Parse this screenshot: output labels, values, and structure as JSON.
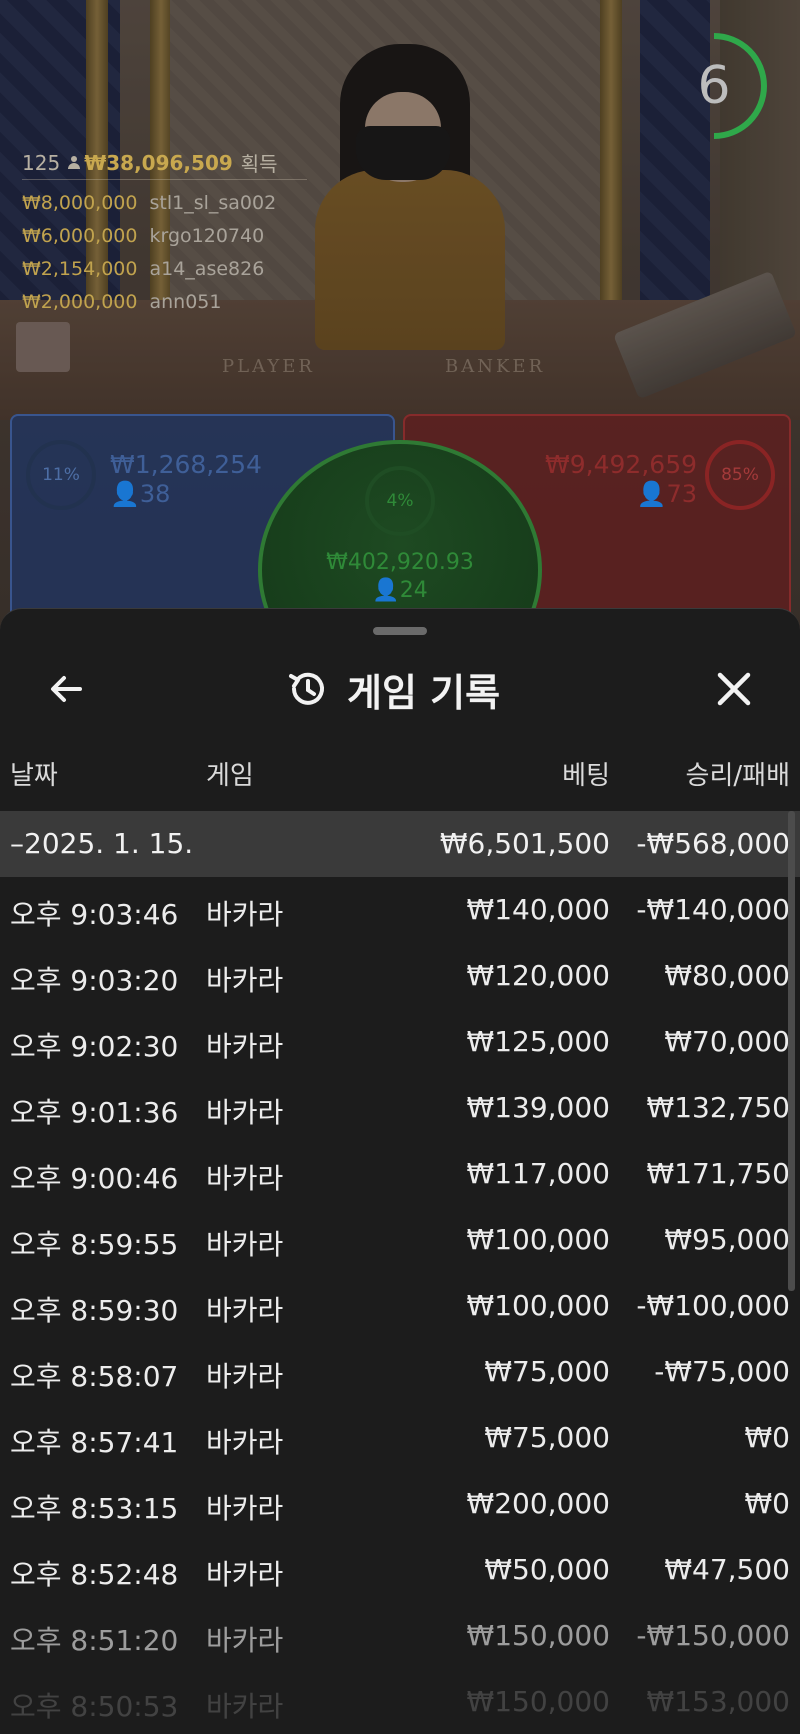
{
  "live": {
    "timer": "6",
    "winners_count": "125",
    "winners_total": "₩38,096,509",
    "winners_suffix": "획득",
    "winners": [
      {
        "amount": "₩8,000,000",
        "name": "stl1_sl_sa002"
      },
      {
        "amount": "₩6,000,000",
        "name": "krgo120740"
      },
      {
        "amount": "₩2,154,000",
        "name": "a14_ase826"
      },
      {
        "amount": "₩2,000,000",
        "name": "ann051"
      }
    ],
    "table_labels": {
      "player": "PLAYER",
      "banker": "BANKER"
    },
    "player": {
      "pct": "11%",
      "amount": "₩1,268,254",
      "count": "38"
    },
    "banker": {
      "pct": "85%",
      "amount": "₩9,492,659",
      "count": "73"
    },
    "tie": {
      "pct": "4%",
      "amount": "₩402,920.93",
      "count": "24"
    }
  },
  "history": {
    "title": "게임 기록",
    "columns": {
      "date": "날짜",
      "game": "게임",
      "bet": "베팅",
      "result": "승리/패배"
    },
    "day": {
      "date": "–2025. 1. 15.",
      "bet": "₩6,501,500",
      "result": "-₩568,000"
    },
    "rows": [
      {
        "time": "오후 9:03:46",
        "game": "바카라",
        "bet": "₩140,000",
        "result": "-₩140,000"
      },
      {
        "time": "오후 9:03:20",
        "game": "바카라",
        "bet": "₩120,000",
        "result": "₩80,000"
      },
      {
        "time": "오후 9:02:30",
        "game": "바카라",
        "bet": "₩125,000",
        "result": "₩70,000"
      },
      {
        "time": "오후 9:01:36",
        "game": "바카라",
        "bet": "₩139,000",
        "result": "₩132,750"
      },
      {
        "time": "오후 9:00:46",
        "game": "바카라",
        "bet": "₩117,000",
        "result": "₩171,750"
      },
      {
        "time": "오후 8:59:55",
        "game": "바카라",
        "bet": "₩100,000",
        "result": "₩95,000"
      },
      {
        "time": "오후 8:59:30",
        "game": "바카라",
        "bet": "₩100,000",
        "result": "-₩100,000"
      },
      {
        "time": "오후 8:58:07",
        "game": "바카라",
        "bet": "₩75,000",
        "result": "-₩75,000"
      },
      {
        "time": "오후 8:57:41",
        "game": "바카라",
        "bet": "₩75,000",
        "result": "₩0"
      },
      {
        "time": "오후 8:53:15",
        "game": "바카라",
        "bet": "₩200,000",
        "result": "₩0"
      },
      {
        "time": "오후 8:52:48",
        "game": "바카라",
        "bet": "₩50,000",
        "result": "₩47,500"
      },
      {
        "time": "오후 8:51:20",
        "game": "바카라",
        "bet": "₩150,000",
        "result": "-₩150,000"
      },
      {
        "time": "오후 8:50:53",
        "game": "바카라",
        "bet": "₩150,000",
        "result": "₩153,000"
      }
    ]
  }
}
